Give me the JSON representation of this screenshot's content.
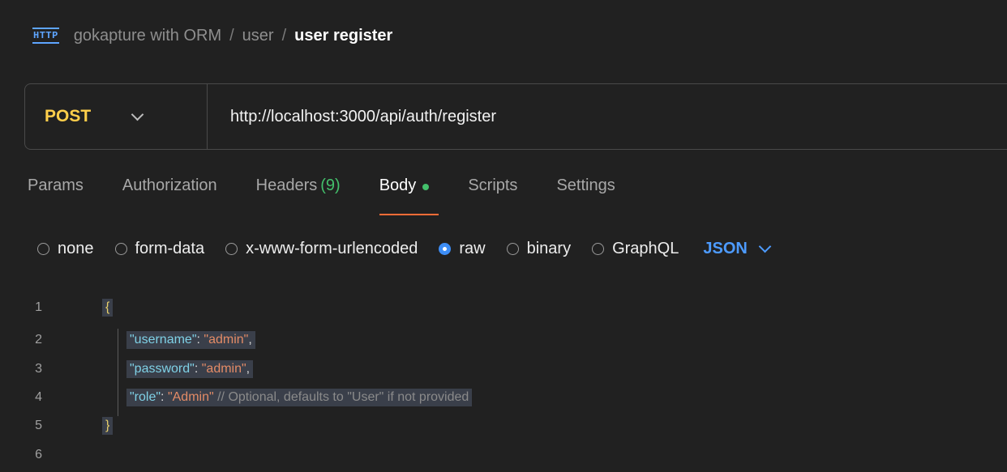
{
  "breadcrumb": {
    "icon": "HTTP",
    "collection": "gokapture with ORM",
    "folder": "user",
    "request": "user register",
    "separator": "/"
  },
  "request": {
    "method": "POST",
    "url": "http://localhost:3000/api/auth/register"
  },
  "tabs": [
    {
      "label": "Params"
    },
    {
      "label": "Authorization"
    },
    {
      "label": "Headers",
      "count": "(9)"
    },
    {
      "label": "Body"
    },
    {
      "label": "Scripts"
    },
    {
      "label": "Settings"
    }
  ],
  "body_types": [
    "none",
    "form-data",
    "x-www-form-urlencoded",
    "raw",
    "binary",
    "GraphQL"
  ],
  "body_format": "JSON",
  "editor": {
    "line_numbers": [
      "1",
      "2",
      "3",
      "4",
      "5",
      "6"
    ],
    "open_brace": "{",
    "close_brace": "}",
    "lines": [
      {
        "key": "\"username\"",
        "colon": ": ",
        "value": "\"admin\"",
        "trail": ","
      },
      {
        "key": "\"password\"",
        "colon": ": ",
        "value": "\"admin\"",
        "trail": ","
      },
      {
        "key": "\"role\"",
        "colon": ": ",
        "value": "\"Admin\"",
        "trail": " ",
        "comment": "// Optional, defaults to \"User\" if not provided"
      }
    ]
  },
  "colors": {
    "method": "#ffcf4b",
    "active_tab_underline": "#ff6c37",
    "accent": "#3d8ef7",
    "status_dot": "#43c06b"
  }
}
